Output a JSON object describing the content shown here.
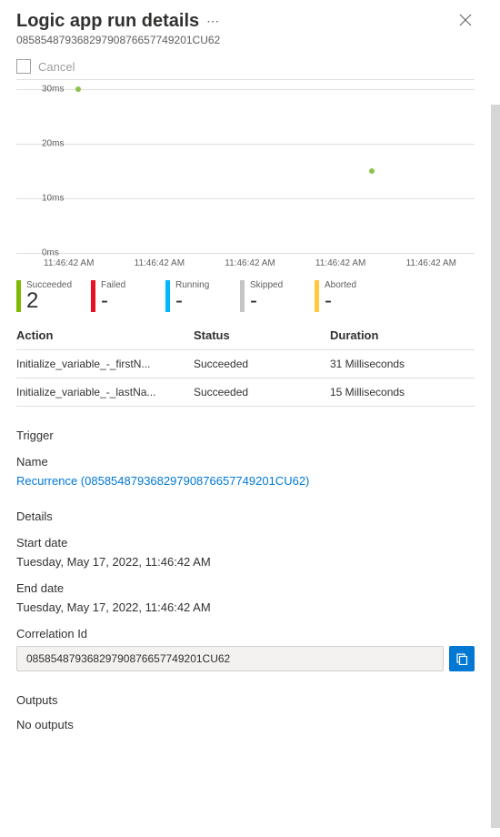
{
  "header": {
    "title": "Logic app run details",
    "subtitle": "08585487936829790876657749201CU62"
  },
  "cancel_label": "Cancel",
  "chart_data": {
    "type": "scatter",
    "ylabel": "",
    "xlabel": "",
    "y_ticks": [
      "30ms",
      "20ms",
      "10ms",
      "0ms"
    ],
    "x_ticks": [
      "11:46:42 AM",
      "11:46:42 AM",
      "11:46:42 AM",
      "11:46:42 AM",
      "11:46:42 AM"
    ],
    "ylim": [
      0,
      30
    ],
    "points": [
      {
        "x": 0,
        "y": 31
      },
      {
        "x": 3,
        "y": 15
      }
    ],
    "unit": "ms"
  },
  "statuses": [
    {
      "label": "Succeeded",
      "value": "2",
      "color": "#7fba00"
    },
    {
      "label": "Failed",
      "value": "-",
      "color": "#e81123"
    },
    {
      "label": "Running",
      "value": "-",
      "color": "#00b7ff"
    },
    {
      "label": "Skipped",
      "value": "-",
      "color": "#c4c4c4"
    },
    {
      "label": "Aborted",
      "value": "-",
      "color": "#ffc83d"
    }
  ],
  "table": {
    "headers": {
      "action": "Action",
      "status": "Status",
      "duration": "Duration"
    },
    "rows": [
      {
        "action": "Initialize_variable_-_firstN...",
        "status": "Succeeded",
        "duration": "31 Milliseconds"
      },
      {
        "action": "Initialize_variable_-_lastNa...",
        "status": "Succeeded",
        "duration": "15 Milliseconds"
      }
    ]
  },
  "trigger": {
    "section_label": "Trigger",
    "name_label": "Name",
    "name_value": "Recurrence (08585487936829790876657749201CU62)"
  },
  "details": {
    "section_label": "Details",
    "start_label": "Start date",
    "start_value": "Tuesday, May 17, 2022, 11:46:42 AM",
    "end_label": "End date",
    "end_value": "Tuesday, May 17, 2022, 11:46:42 AM",
    "correlation_label": "Correlation Id",
    "correlation_value": "08585487936829790876657749201CU62"
  },
  "outputs": {
    "section_label": "Outputs",
    "value": "No outputs"
  }
}
